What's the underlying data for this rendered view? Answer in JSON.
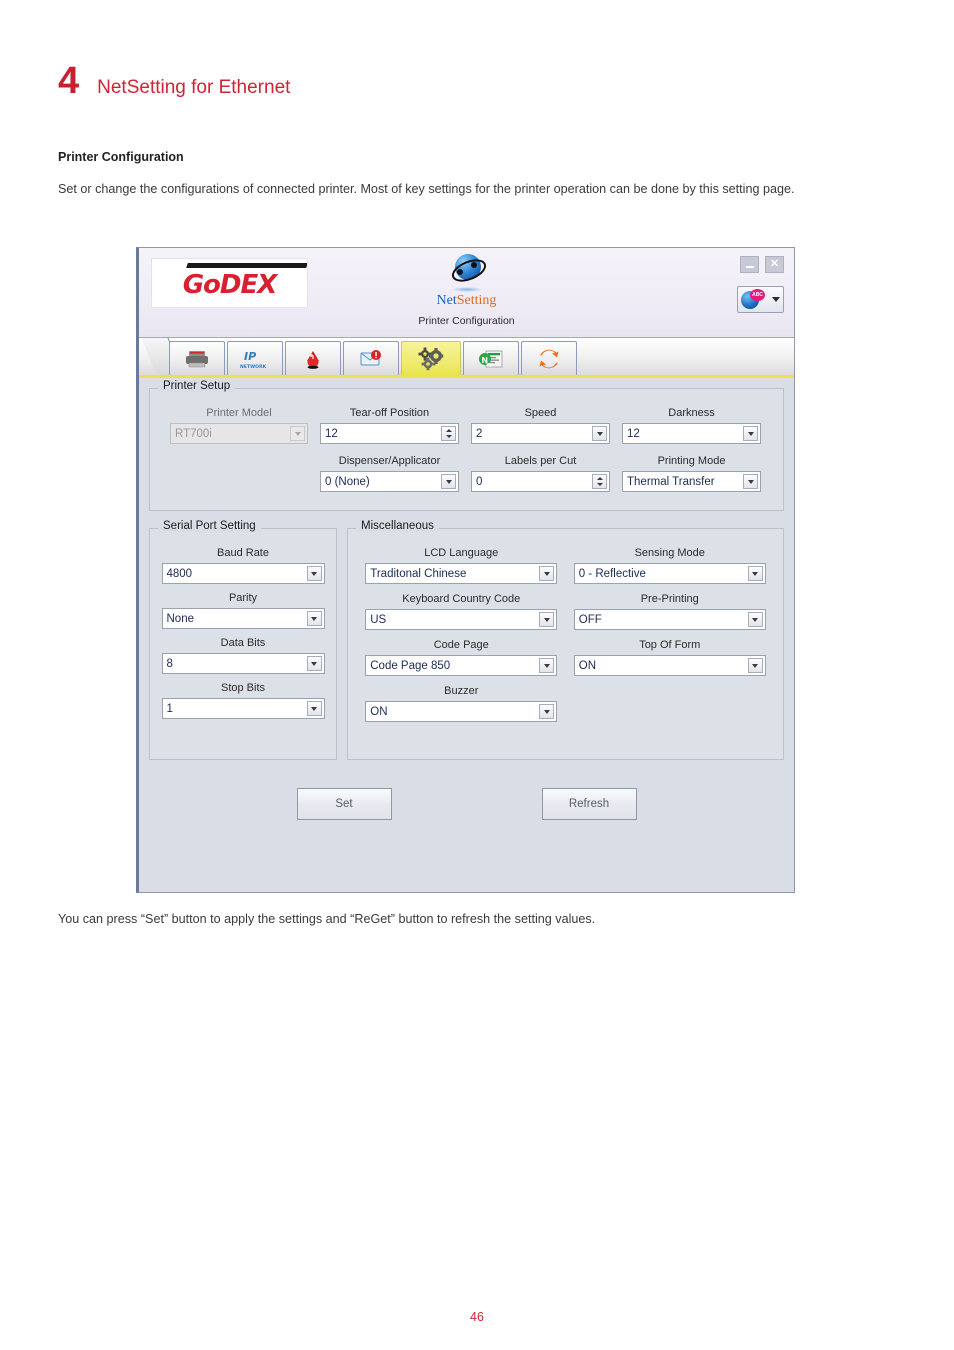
{
  "document": {
    "chapter_number": "4",
    "chapter_title": "NetSetting for Ethernet",
    "section_title": "Printer Configuration",
    "intro_paragraph": "Set or change the configurations of connected printer. Most of key settings for the printer operation can be done by this setting page.",
    "caption": "You can press “Set” button to apply the settings and “ReGet” button to refresh the setting values.",
    "page_number": "46",
    "accent_color": "#cf2436"
  },
  "app": {
    "brand_logo_text": "GoDEX",
    "product_name_part1": "Net",
    "product_name_part2": "Setting",
    "window_subtitle": "Printer Configuration",
    "window_controls": {
      "minimize": "–",
      "close": "✕"
    },
    "language_button": {
      "icon": "globe-abc-icon",
      "caret": "▾"
    },
    "tabs": [
      {
        "id": "printer",
        "icon": "printer-icon",
        "active": false
      },
      {
        "id": "ip-network",
        "icon": "ip-network-icon",
        "active": false
      },
      {
        "id": "alert",
        "icon": "alert-bell-icon",
        "active": false
      },
      {
        "id": "mail",
        "icon": "mail-alert-icon",
        "active": false
      },
      {
        "id": "printer-config",
        "icon": "gears-icon",
        "active": true
      },
      {
        "id": "label-editor",
        "icon": "label-editor-icon",
        "active": false
      },
      {
        "id": "refresh",
        "icon": "refresh-arrows-icon",
        "active": false
      }
    ]
  },
  "printer_setup": {
    "legend": "Printer Setup",
    "fields": {
      "printer_model": {
        "label": "Printer Model",
        "value": "RT700i",
        "control": "select",
        "disabled": true
      },
      "tear_off_position": {
        "label": "Tear-off  Position",
        "value": "12",
        "control": "spinner"
      },
      "speed": {
        "label": "Speed",
        "value": "2",
        "control": "select"
      },
      "darkness": {
        "label": "Darkness",
        "value": "12",
        "control": "select"
      },
      "dispenser": {
        "label": "Dispenser/Applicator",
        "value": "0 (None)",
        "control": "select"
      },
      "labels_per_cut": {
        "label": "Labels per Cut",
        "value": "0",
        "control": "spinner"
      },
      "printing_mode": {
        "label": "Printing Mode",
        "value": "Thermal Transfer",
        "control": "select"
      }
    }
  },
  "serial_port": {
    "legend": "Serial Port Setting",
    "fields": [
      {
        "label": "Baud Rate",
        "value": "4800"
      },
      {
        "label": "Parity",
        "value": "None"
      },
      {
        "label": "Data Bits",
        "value": "8"
      },
      {
        "label": "Stop Bits",
        "value": "1"
      }
    ]
  },
  "miscellaneous": {
    "legend": "Miscellaneous",
    "fields": [
      {
        "label": "LCD Language",
        "value": "Traditonal Chinese"
      },
      {
        "label": "Sensing Mode",
        "value": "0 - Reflective"
      },
      {
        "label": "Keyboard Country Code",
        "value": "US"
      },
      {
        "label": "Pre-Printing",
        "value": "OFF"
      },
      {
        "label": "Code Page",
        "value": "Code Page 850"
      },
      {
        "label": "Top Of Form",
        "value": "ON"
      },
      {
        "label": "Buzzer",
        "value": "ON"
      }
    ]
  },
  "actions": {
    "set_label": "Set",
    "refresh_label": "Refresh"
  }
}
